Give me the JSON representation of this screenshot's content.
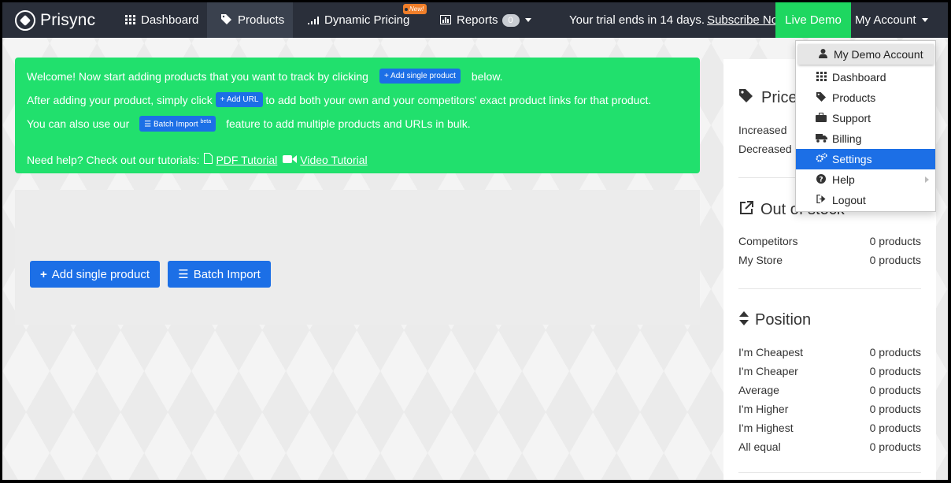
{
  "navbar": {
    "brand": "Prisync",
    "dashboard": "Dashboard",
    "products": "Products",
    "dynamic_pricing": "Dynamic Pricing",
    "new_badge": "New!",
    "reports": "Reports",
    "reports_count": "0",
    "trial_text": "Your trial ends in 14 days.",
    "subscribe_link": "Subscribe Now!",
    "live_demo": "Live Demo",
    "my_account": "My Account"
  },
  "dropdown": {
    "items": [
      {
        "label": "My Demo Account",
        "icon": "user-icon"
      },
      {
        "label": "Dashboard",
        "icon": "grid-icon"
      },
      {
        "label": "Products",
        "icon": "tags-icon"
      },
      {
        "label": "Support",
        "icon": "briefcase-icon"
      },
      {
        "label": "Billing",
        "icon": "truck-icon"
      },
      {
        "label": "Settings",
        "icon": "cogs-icon"
      },
      {
        "label": "Help",
        "icon": "question-icon"
      },
      {
        "label": "Logout",
        "icon": "sign-out-icon"
      }
    ],
    "active_color": "#1c6fe6"
  },
  "welcome": {
    "line1_pre": "Welcome! Now start adding products that you want to track by clicking",
    "line1_btn": "+ Add single product",
    "line1_post": "below.",
    "line2_pre": "After adding your product, simply click",
    "line2_btn": "+ Add URL",
    "line2_post": "to add both your own and your competitors' exact product links for that product.",
    "line3_pre": "You can also use our",
    "line3_btn": "Batch Import",
    "line3_btn_sup": "beta",
    "line3_post": "feature to add multiple products and URLs in bulk.",
    "help_text": "Need help? Check out our tutorials:",
    "pdf_tutorial": "PDF Tutorial",
    "video_tutorial": "Video Tutorial",
    "bg_color": "#21e06d"
  },
  "panel": {
    "add_single_product": "Add single product",
    "batch_import": "Batch Import"
  },
  "sidebar": {
    "price_title": "Price",
    "price_rows": [
      {
        "label": "Increased"
      },
      {
        "label": "Decreased"
      }
    ],
    "stock_title": "Out of stock",
    "stock_rows": [
      {
        "label": "Competitors",
        "value": "0 products"
      },
      {
        "label": "My Store",
        "value": "0 products"
      }
    ],
    "position_title": "Position",
    "position_rows": [
      {
        "label": "I'm Cheapest",
        "value": "0 products"
      },
      {
        "label": "I'm Cheaper",
        "value": "0 products"
      },
      {
        "label": "Average",
        "value": "0 products"
      },
      {
        "label": "I'm Higher",
        "value": "0 products"
      },
      {
        "label": "I'm Highest",
        "value": "0 products"
      },
      {
        "label": "All equal",
        "value": "0 products"
      }
    ]
  },
  "colors": {
    "navbar": "#2a2f3a",
    "primary": "#1c6fe6",
    "live_demo": "#1ed760"
  }
}
